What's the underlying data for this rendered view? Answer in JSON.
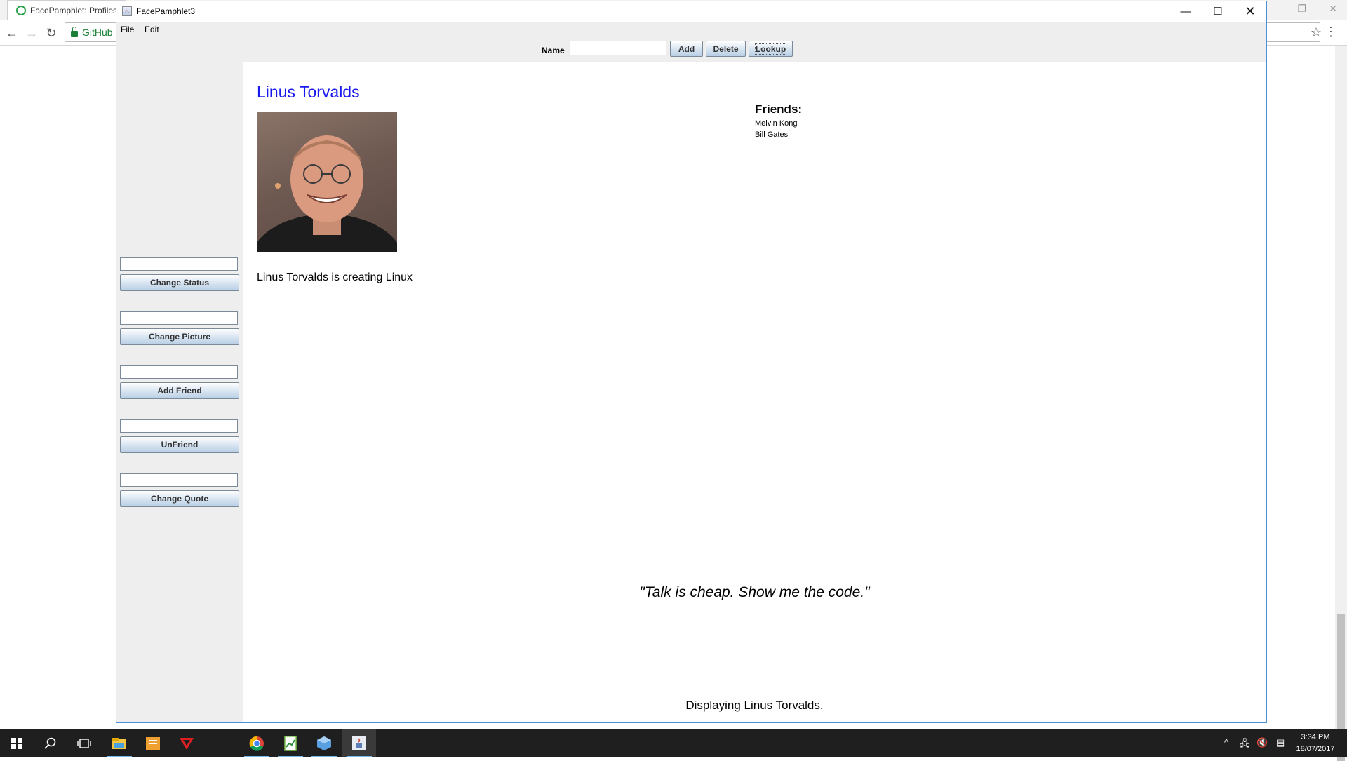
{
  "browser": {
    "tab_title": "FacePamphlet: Profiles",
    "address_text": "GitHub"
  },
  "app": {
    "window_title": "FacePamphlet3",
    "menu": [
      "File",
      "Edit"
    ],
    "top_bar": {
      "name_label": "Name",
      "name_value": "",
      "add_label": "Add",
      "delete_label": "Delete",
      "lookup_label": "Lookup"
    },
    "sidebar": {
      "fields": [
        {
          "value": "",
          "button_label": "Change Status"
        },
        {
          "value": "",
          "button_label": "Change Picture"
        },
        {
          "value": "",
          "button_label": "Add Friend"
        },
        {
          "value": "",
          "button_label": "UnFriend"
        },
        {
          "value": "",
          "button_label": "Change Quote"
        }
      ]
    },
    "profile": {
      "name": "Linus Torvalds",
      "status": "Linus Torvalds is creating Linux",
      "friends_heading": "Friends:",
      "friends": [
        "Melvin Kong",
        "Bill Gates"
      ],
      "quote": "\"Talk is cheap. Show me the code.\"",
      "message": "Displaying Linus Torvalds."
    }
  },
  "taskbar": {
    "time": "3:34 PM",
    "date": "18/07/2017"
  },
  "colors": {
    "profile_name": "#1a1af0",
    "window_border": "#4a90d9",
    "taskbar": "#1f1f1f"
  }
}
